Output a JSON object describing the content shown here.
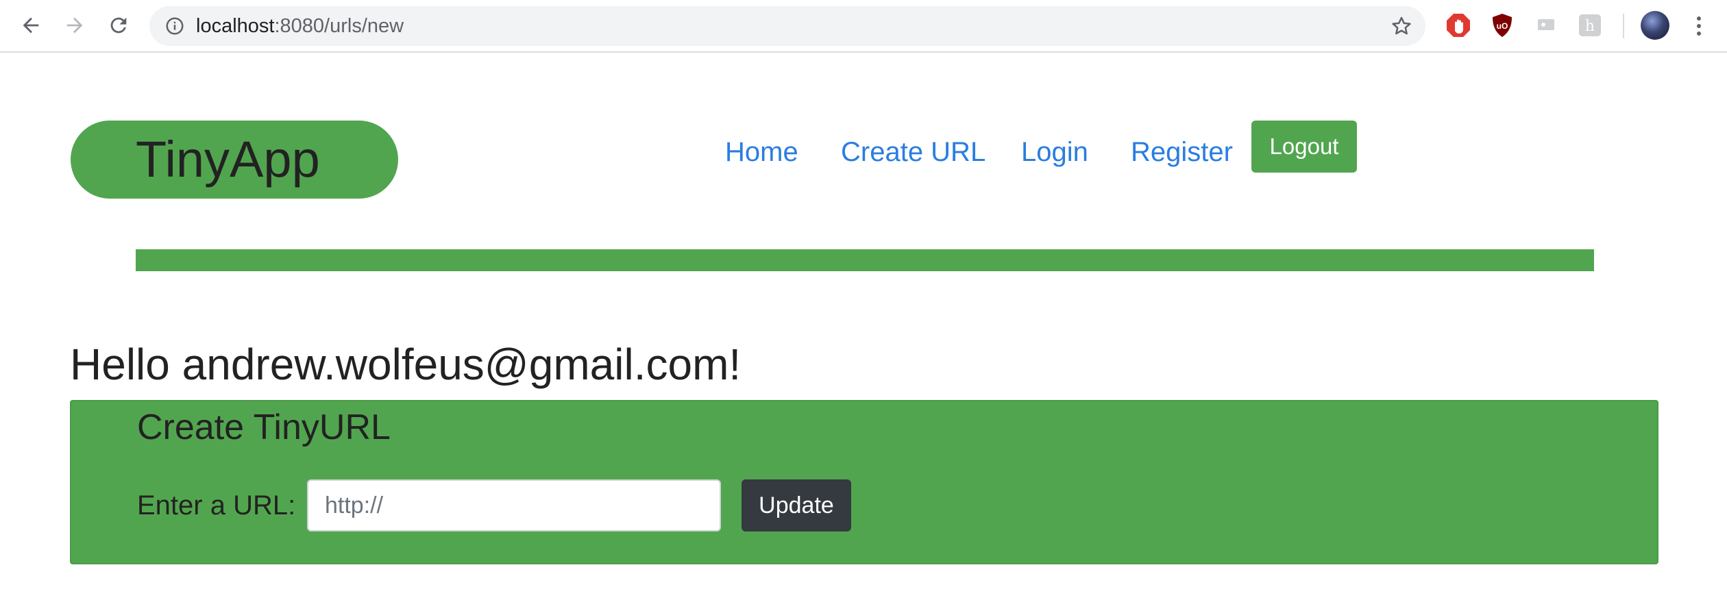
{
  "browser": {
    "url_host": "localhost",
    "url_rest": ":8080/urls/new"
  },
  "nav": {
    "brand": "TinyApp",
    "links": [
      "Home",
      "Create URL",
      "Login",
      "Register"
    ],
    "logout_label": "Logout"
  },
  "main": {
    "greeting": "Hello andrew.wolfeus@gmail.com!",
    "form_title": "Create TinyURL",
    "url_label": "Enter a URL:",
    "url_placeholder": "http://",
    "url_value": "",
    "submit_label": "Update"
  },
  "colors": {
    "brand_green": "#52a54f",
    "link_blue": "#2a7de1",
    "dark_button": "#343a40"
  },
  "icons": {
    "back": "arrow-left-icon",
    "forward": "arrow-right-icon",
    "reload": "reload-icon",
    "site_info": "info-icon",
    "bookmark": "star-icon",
    "extensions": [
      "adblock-icon",
      "ublock-icon",
      "cast-icon",
      "heroku-icon"
    ],
    "profile": "avatar",
    "menu": "kebab-menu-icon"
  }
}
